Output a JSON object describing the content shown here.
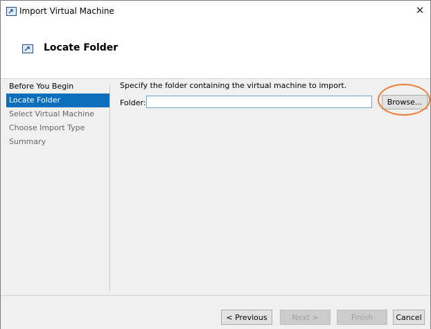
{
  "window": {
    "title": "Import Virtual Machine",
    "close_glyph": "✕"
  },
  "header": {
    "title": "Locate Folder"
  },
  "sidebar": {
    "items": [
      {
        "label": "Before You Begin",
        "state": "normal"
      },
      {
        "label": "Locate Folder",
        "state": "active"
      },
      {
        "label": "Select Virtual Machine",
        "state": "dim"
      },
      {
        "label": "Choose Import Type",
        "state": "dim"
      },
      {
        "label": "Summary",
        "state": "dim"
      }
    ]
  },
  "main": {
    "instruction": "Specify the folder containing the virtual machine to import.",
    "folder_label": "Folder:",
    "folder_value": "",
    "browse_label": "Browse..."
  },
  "footer": {
    "previous_label": "< Previous",
    "next_label": "Next >",
    "finish_label": "Finish",
    "cancel_label": "Cancel"
  },
  "colors": {
    "accent": "#0b6fbd",
    "highlight": "#ed7d31"
  }
}
